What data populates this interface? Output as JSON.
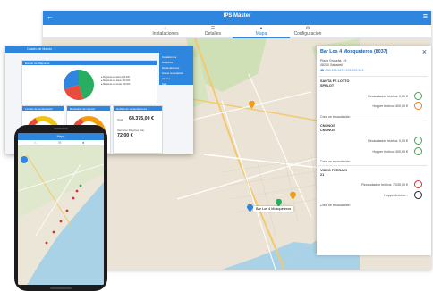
{
  "app": {
    "title": "IPS Máster",
    "tabs": [
      {
        "label": "Instalaciones",
        "icon": "home-icon"
      },
      {
        "label": "Detalles",
        "icon": "list-icon"
      },
      {
        "label": "Mapa",
        "icon": "map-pin-icon"
      },
      {
        "label": "Configuración",
        "icon": "gear-icon"
      }
    ],
    "active_tab": "Mapa"
  },
  "map": {
    "popup_label": "Bar Los 4 Mosqueteros"
  },
  "panel": {
    "title": "Bar Los 4 Mosqueteros (8037)",
    "address_line1": "Plaça Grosella, 49",
    "address_line2": "08200 Sabadell",
    "phones": "999 876 543 / 678 876 543",
    "machines": [
      {
        "name_line1": "SANTA FE LOTTO",
        "name_line2": "SPELOT",
        "rows": [
          {
            "label": "Recaudación teórica: 0,00 €",
            "value": "0%",
            "color": "#3aa845"
          },
          {
            "label": "Hopper teórico: 400,00 €",
            "value": "0%",
            "color": "#e67e22"
          }
        ],
        "footer": "Crea un recaudación"
      },
      {
        "name_line1": "CNONOS",
        "name_line2": "CNONOS",
        "rows": [
          {
            "label": "Recaudación teórica: 0,00 €",
            "value": "0%",
            "color": "#3aa845"
          },
          {
            "label": "Hopper teórico: 400,00 €",
            "value": "0%",
            "color": "#3aa845"
          }
        ],
        "footer": "Crea un recaudación"
      },
      {
        "name_line1": "VIDEO FERRARI",
        "name_line2": "21",
        "rows": [
          {
            "label": "Recaudación teórica: 7.035,00 €",
            "value": "0%",
            "color": "#d63031"
          },
          {
            "label": "Hopper teórico: -",
            "value": "",
            "color": "#222222"
          }
        ],
        "footer": "Crea un recaudación"
      }
    ]
  },
  "dash": {
    "title": "Cuadro de Mando",
    "card1_title": "Estado de Máquinas",
    "legend": [
      "Máquinas en alerta 100.000",
      "Máquinas sin datos 100.000",
      "Máquinas correctas 100.000"
    ],
    "card2_title": "Límites de recaudación",
    "card3_title": "Recaudos de Hopper",
    "card4_title": "Gráfica de recaudaciones",
    "total_label": "Total",
    "total_value": "64.375,00 €",
    "avg_label": "Valoración Máquinas (día)",
    "avg_value": "72,00 €",
    "side_items": [
      "Instalaciones",
      "Máquinas",
      "Recaudaciones",
      "Nueva recaudación",
      "Ajustes",
      "Salir"
    ],
    "pie": [
      {
        "name": "Máquinas en alerta",
        "value": 0.45,
        "color": "#27ae60"
      },
      {
        "name": "Máquinas sin datos",
        "value": 0.25,
        "color": "#e74c3c"
      },
      {
        "name": "Máquinas correctas",
        "value": 0.3,
        "color": "#2e86de"
      }
    ]
  },
  "phone": {
    "title": "Mapa"
  }
}
